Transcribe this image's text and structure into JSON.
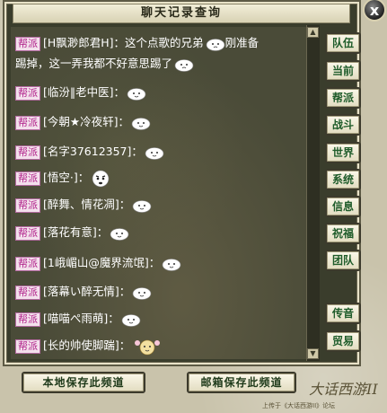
{
  "window": {
    "title": "聊天记录查询",
    "close_glyph": "x"
  },
  "messages": [
    {
      "channel": "帮派",
      "line1": "[H飘渺郎君H]：这个点歌的兄弟",
      "after_emote": "刚准备",
      "line2": "踢掉，这一弄我都不好意思踢了"
    },
    {
      "channel": "帮派",
      "text": "[临汾‖老中医]："
    },
    {
      "channel": "帮派",
      "text": "[今朝★冷夜轩]："
    },
    {
      "channel": "帮派",
      "text": "[名字37612357]："
    },
    {
      "channel": "帮派",
      "text": "[悟空·]："
    },
    {
      "channel": "帮派",
      "text": "[醉舞、情花凋]："
    },
    {
      "channel": "帮派",
      "text": "[落花有意]："
    },
    {
      "channel": "帮派",
      "text": "[1峨嵋山@魔界流氓]："
    },
    {
      "channel": "帮派",
      "text": "[落幕い醉无情]："
    },
    {
      "channel": "帮派",
      "text": "[喵喵ぺ雨萌]："
    },
    {
      "channel": "帮派",
      "text": "[长的帅使脚踹]："
    }
  ],
  "side_buttons": [
    "队伍",
    "当前",
    "帮派",
    "战斗",
    "世界",
    "系统",
    "信息",
    "祝福",
    "团队",
    "传音",
    "贸易"
  ],
  "bottom_buttons": {
    "save_local": "本地保存此频道",
    "save_mail": "邮箱保存此频道"
  },
  "logo_text": "大话西游II",
  "footer_note": "上传于《大话西游II》论坛",
  "colors": {
    "tag_text": "#b0208a",
    "button_text": "#1f5c2a",
    "chat_bg": "#4a4b38"
  }
}
